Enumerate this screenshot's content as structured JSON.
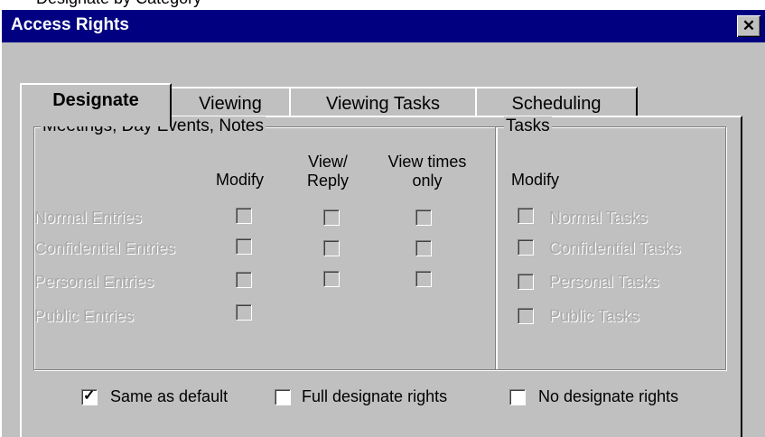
{
  "window": {
    "title": "Access Rights",
    "top_fragment": "Designate by Category"
  },
  "tabs": [
    {
      "label": "Designate",
      "active": true
    },
    {
      "label": "Viewing",
      "active": false
    },
    {
      "label": "Viewing Tasks",
      "active": false
    },
    {
      "label": "Scheduling",
      "active": false
    }
  ],
  "meetings_group": {
    "title": "Meetings, Day Events, Notes",
    "col_modify": "Modify",
    "col_view_reply": "View/\nReply",
    "col_view_times": "View times\nonly",
    "rows": [
      {
        "label": "Normal Entries",
        "modify": false,
        "view_reply": false,
        "view_times": false
      },
      {
        "label": "Confidential Entries",
        "modify": false,
        "view_reply": false,
        "view_times": false
      },
      {
        "label": "Personal Entries",
        "modify": false,
        "view_reply": false,
        "view_times": false
      },
      {
        "label": "Public Entries",
        "modify": false
      }
    ]
  },
  "tasks_group": {
    "title": "Tasks",
    "col_modify": "Modify",
    "rows": [
      {
        "label": "Normal Tasks",
        "checked": false
      },
      {
        "label": "Confidential Tasks",
        "checked": false
      },
      {
        "label": "Personal Tasks",
        "checked": false
      },
      {
        "label": "Public Tasks",
        "checked": false
      }
    ]
  },
  "bottom_options": [
    {
      "label": "Same as default",
      "checked": true
    },
    {
      "label": "Full designate rights",
      "checked": false
    },
    {
      "label": "No designate rights",
      "checked": false
    }
  ]
}
